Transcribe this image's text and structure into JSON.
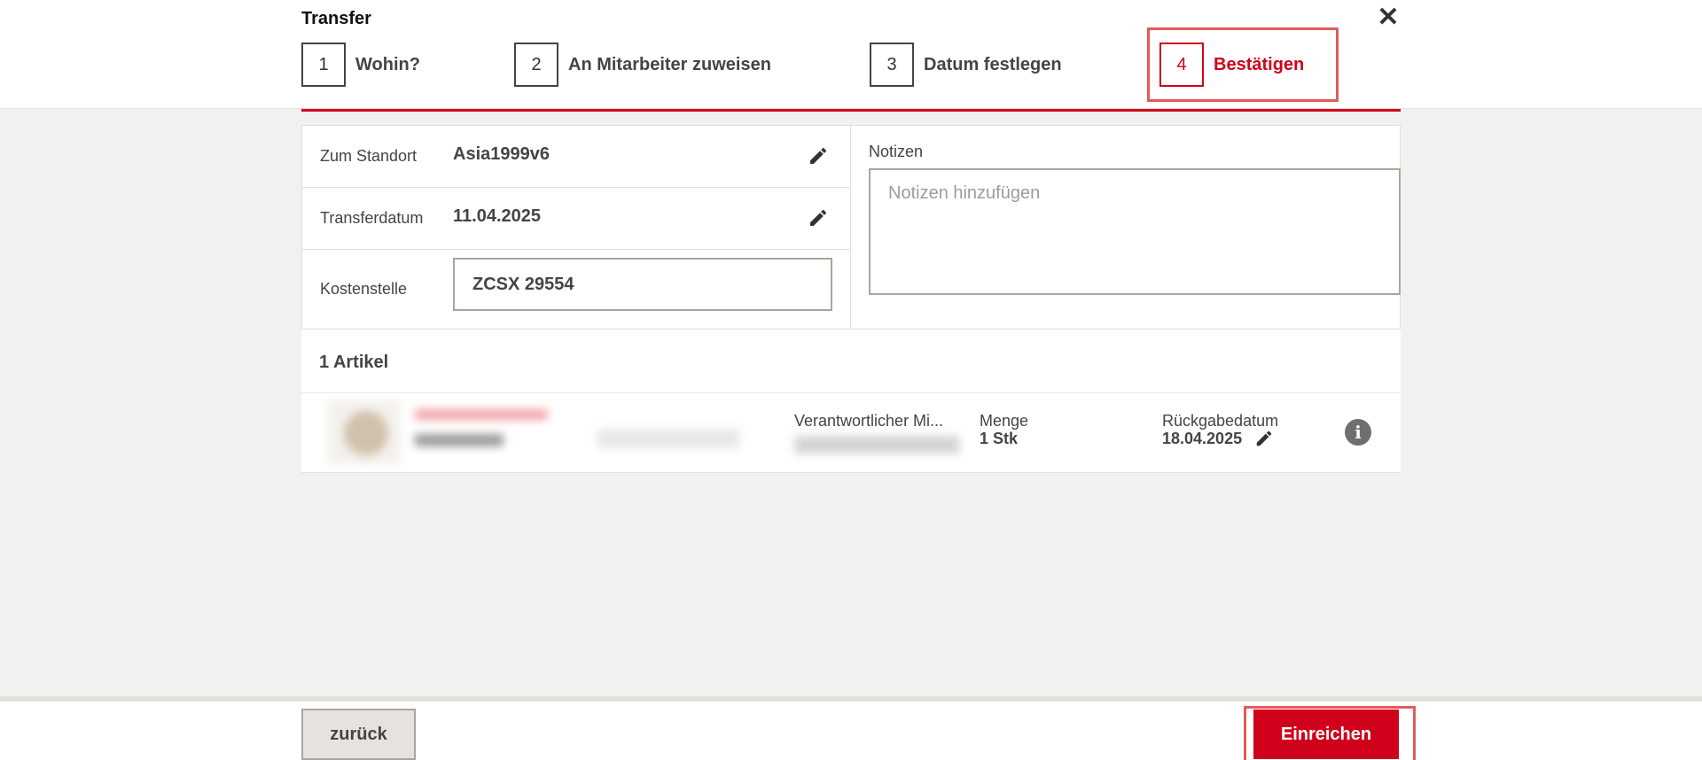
{
  "dialog": {
    "title": "Transfer"
  },
  "steps": [
    {
      "number": "1",
      "label": "Wohin?"
    },
    {
      "number": "2",
      "label": "An Mitarbeiter zuweisen"
    },
    {
      "number": "3",
      "label": "Datum festlegen"
    },
    {
      "number": "4",
      "label": "Bestätigen"
    }
  ],
  "summary": {
    "location_label": "Zum Standort",
    "location_value": "Asia1999v6",
    "date_label": "Transferdatum",
    "date_value": "11.04.2025",
    "cost_center_label": "Kostenstelle",
    "cost_center_value": "ZCSX 29554"
  },
  "notes": {
    "label": "Notizen",
    "placeholder": "Notizen hinzufügen",
    "value": ""
  },
  "articles": {
    "count_label": "1 Artikel",
    "items": [
      {
        "responsible_label": "Verantwortlicher Mi...",
        "quantity_label": "Menge",
        "quantity_value": "1 Stk",
        "return_date_label": "Rückgabedatum",
        "return_date_value": "18.04.2025"
      }
    ]
  },
  "footer": {
    "back_label": "zurück",
    "submit_label": "Einreichen"
  },
  "colors": {
    "accent": "#d0021b",
    "highlight": "#e45b5b",
    "background": "#f2f1ef"
  },
  "icons": {
    "close": "close-icon",
    "edit": "pencil-icon",
    "info": "info-icon"
  }
}
